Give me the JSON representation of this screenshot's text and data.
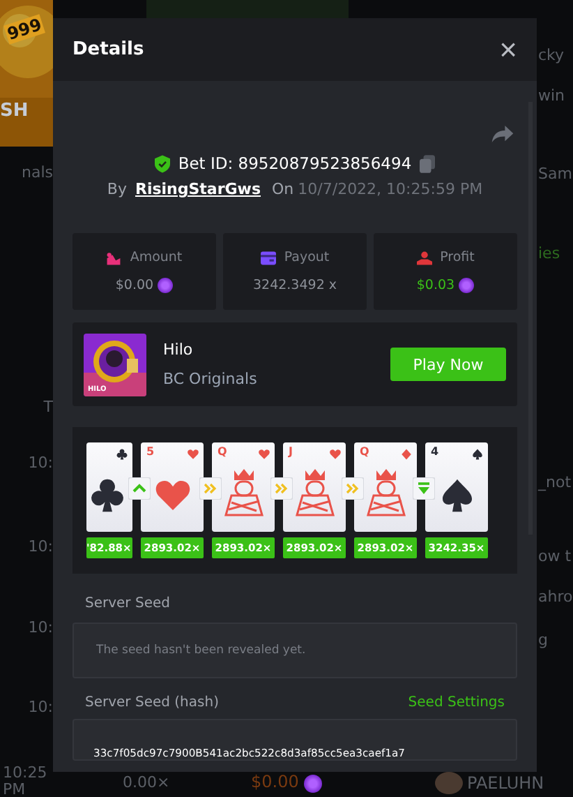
{
  "background": {
    "banner_texts": [
      "999",
      "SH"
    ],
    "left_texts": [
      "nals",
      "T",
      "10:",
      "10:",
      "10:",
      "10:"
    ],
    "right_texts": [
      "cky",
      "win",
      "Sam",
      "ies",
      "_not",
      "ow t",
      "ahro",
      "g"
    ],
    "bottom_row": {
      "time": "10:25",
      "period": "PM",
      "multiplier": "0.00×",
      "amount": "$0.00",
      "player": "PAELUHN"
    }
  },
  "modal": {
    "title": "Details",
    "close": "×",
    "bet_id": "Bet ID: 89520879523856494",
    "by_label": "By",
    "user": "RisingStarGws",
    "on_label": "On",
    "date": "10/7/2022, 10:25:59 PM",
    "stats": [
      {
        "kind": "amount",
        "label": "Amount",
        "value": "$0.00",
        "coin": true,
        "positive": false
      },
      {
        "kind": "payout",
        "label": "Payout",
        "value": "3242.3492 x",
        "coin": false,
        "positive": false
      },
      {
        "kind": "profit",
        "label": "Profit",
        "value": "$0.03",
        "coin": true,
        "positive": true
      }
    ],
    "game": {
      "name": "Hilo",
      "provider": "BC Originals",
      "thumbnail_label": "HILO",
      "button": "Play Now"
    },
    "cards": [
      {
        "kind": "club",
        "multiplier": "'82.88×"
      },
      {
        "rank": "5",
        "kind": "heart",
        "multiplier": "2893.02×"
      },
      {
        "rank": "Q",
        "kind": "heart",
        "face": true,
        "multiplier": "2893.02×"
      },
      {
        "rank": "J",
        "kind": "heart",
        "face": true,
        "multiplier": "2893.02×"
      },
      {
        "rank": "Q",
        "kind": "diamond",
        "face": true,
        "multiplier": "2893.02×"
      },
      {
        "rank": "4",
        "kind": "spade",
        "multiplier": "3242.35×"
      }
    ],
    "guesses": [
      {
        "kind": "higher"
      },
      {
        "kind": "skip"
      },
      {
        "kind": "skip"
      },
      {
        "kind": "skip"
      },
      {
        "kind": "lower-equal"
      }
    ],
    "server_seed_label": "Server Seed",
    "server_seed_placeholder": "The seed hasn't been revealed yet.",
    "hash_label": "Server Seed (hash)",
    "seed_settings": "Seed Settings",
    "hash": "33c7f05dc97c7900B541ac2bc522c8d3af85cc5ea3caef1a7"
  }
}
